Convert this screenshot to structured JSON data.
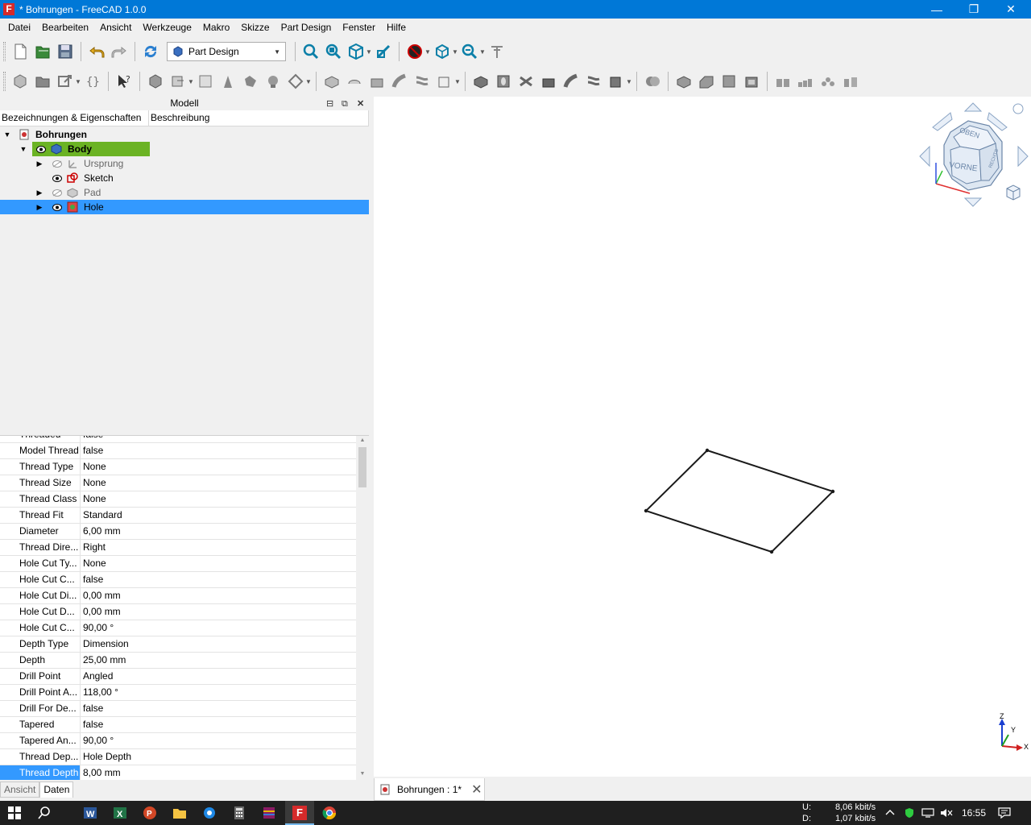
{
  "window": {
    "title": "* Bohrungen - FreeCAD 1.0.0",
    "minimize": "—",
    "restore": "❐",
    "close": "✕"
  },
  "menu": [
    "Datei",
    "Bearbeiten",
    "Ansicht",
    "Werkzeuge",
    "Makro",
    "Skizze",
    "Part Design",
    "Fenster",
    "Hilfe"
  ],
  "workbench": {
    "selected": "Part Design"
  },
  "panel": {
    "title": "Modell",
    "columns": [
      "Bezeichnungen & Eigenschaften",
      "Beschreibung"
    ]
  },
  "tree": [
    {
      "label": "Bohrungen"
    },
    {
      "label": "Body"
    },
    {
      "label": "Ursprung"
    },
    {
      "label": "Sketch"
    },
    {
      "label": "Pad"
    },
    {
      "label": "Hole"
    }
  ],
  "properties": [
    {
      "name": "Threaded",
      "value": "false"
    },
    {
      "name": "Model Thread",
      "value": "false"
    },
    {
      "name": "Thread Type",
      "value": "None"
    },
    {
      "name": "Thread Size",
      "value": "None"
    },
    {
      "name": "Thread Class",
      "value": "None"
    },
    {
      "name": "Thread Fit",
      "value": "Standard"
    },
    {
      "name": "Diameter",
      "value": "6,00 mm"
    },
    {
      "name": "Thread Dire...",
      "value": "Right"
    },
    {
      "name": "Hole Cut Ty...",
      "value": "None"
    },
    {
      "name": "Hole Cut C...",
      "value": "false"
    },
    {
      "name": "Hole Cut Di...",
      "value": "0,00 mm"
    },
    {
      "name": "Hole Cut D...",
      "value": "0,00 mm"
    },
    {
      "name": "Hole Cut C...",
      "value": "90,00 °"
    },
    {
      "name": "Depth Type",
      "value": "Dimension"
    },
    {
      "name": "Depth",
      "value": "25,00 mm"
    },
    {
      "name": "Drill Point",
      "value": "Angled"
    },
    {
      "name": "Drill Point A...",
      "value": "118,00 °"
    },
    {
      "name": "Drill For De...",
      "value": "false"
    },
    {
      "name": "Tapered",
      "value": "false"
    },
    {
      "name": "Tapered An...",
      "value": "90,00 °"
    },
    {
      "name": "Thread Dep...",
      "value": "Hole Depth"
    },
    {
      "name": "Thread Depth",
      "value": "8,00 mm"
    }
  ],
  "panel_tabs": [
    "Ansicht",
    "Daten"
  ],
  "navcube": {
    "top": "OBEN",
    "front": "VORNE",
    "right": "RECHTS"
  },
  "axes": {
    "x": "X",
    "y": "Y",
    "z": "Z"
  },
  "document_tab": {
    "label": "Bohrungen : 1*",
    "close": "✕"
  },
  "taskbar": {
    "net_up_label": "U:",
    "net_up": "8,06 kbit/s",
    "net_down_label": "D:",
    "net_down": "1,07 kbit/s",
    "time": "16:55"
  },
  "colors": {
    "titlebar": "#0078d7",
    "selection": "#3399ff",
    "body_highlight": "#6bb324",
    "taskbar": "#1f1f1f"
  }
}
